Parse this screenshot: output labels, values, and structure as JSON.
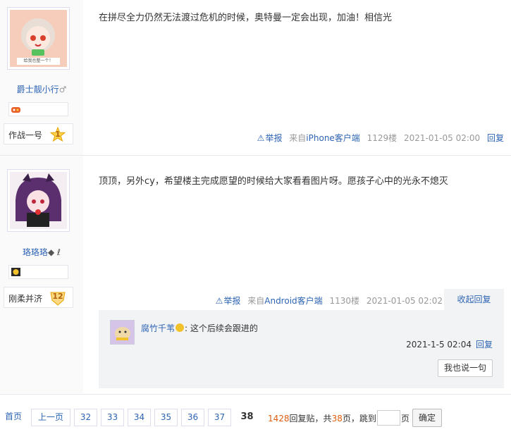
{
  "posts": [
    {
      "username": "爵士靓小行",
      "gender_symbol": "♂",
      "avatar_caption": "给我也整一个！",
      "level_name": "作战一号",
      "level_num": "1",
      "content": "在拼尽全力仍然无法渡过危机的时候，奥特曼一定会出现，加油！相信光",
      "report_label": "举报",
      "source_prefix": "来自",
      "source_client": "iPhone客户端",
      "floor": "1129楼",
      "time": "2021-01-05 02:00",
      "reply_label": "回复"
    },
    {
      "username": "珞珞珞",
      "username_suffix": "◆ ℓ",
      "level_name": "刚柔并济",
      "level_num": "12",
      "content": "顶顶，另外cy，希望楼主完成愿望的时候给大家看看图片呀。愿孩子心中的光永不熄灭",
      "report_label": "举报",
      "source_prefix": "来自",
      "source_client": "Android客户端",
      "floor": "1130楼",
      "time": "2021-01-05 02:02",
      "collapse_label": "收起回复"
    }
  ],
  "lzl": {
    "username": "腐竹千苇",
    "text": ": 这个后续会跟进的",
    "time": "2021-1-5 02:04",
    "reply_label": "回复",
    "say_label": "我也说一句"
  },
  "pager": {
    "first": "首页",
    "prev": "上一页",
    "pages": [
      "32",
      "33",
      "34",
      "35",
      "36",
      "37"
    ],
    "current": "38",
    "total_replies": "1428",
    "replies_label": "回复贴，共",
    "total_pages": "38",
    "pages_label": "页，",
    "jump_label": "跳到",
    "page_unit": "页",
    "confirm": "确定"
  },
  "colors": {
    "link": "#2d64b3",
    "orange": "#e05d10",
    "side_bg": "#fafafa",
    "lzl_bg": "#f2f3f5"
  }
}
